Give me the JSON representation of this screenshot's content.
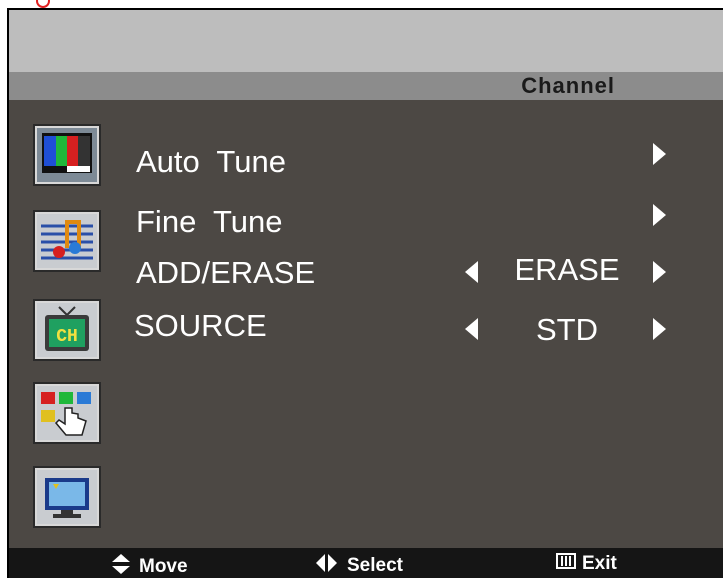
{
  "osd": {
    "title": "Channel",
    "menu_items": [
      {
        "label": "Auto  Tune",
        "value": ""
      },
      {
        "label": "Fine  Tune",
        "value": ""
      },
      {
        "label": "ADD/ERASE",
        "value": "ERASE"
      },
      {
        "label": "SOURCE",
        "value": "STD"
      }
    ],
    "side_icons": [
      "picture-icon",
      "sound-icon",
      "channel-icon",
      "function-icon",
      "screen-icon"
    ],
    "footer": {
      "move_label": "Move",
      "select_label": "Select",
      "exit_label": "Exit",
      "exit_button_text": "III"
    },
    "colors": {
      "background": "#4c4844",
      "title_bar": "#8c8c8c",
      "top_band": "#bdbdbd",
      "footer": "#151515",
      "text": "#ffffff"
    }
  }
}
